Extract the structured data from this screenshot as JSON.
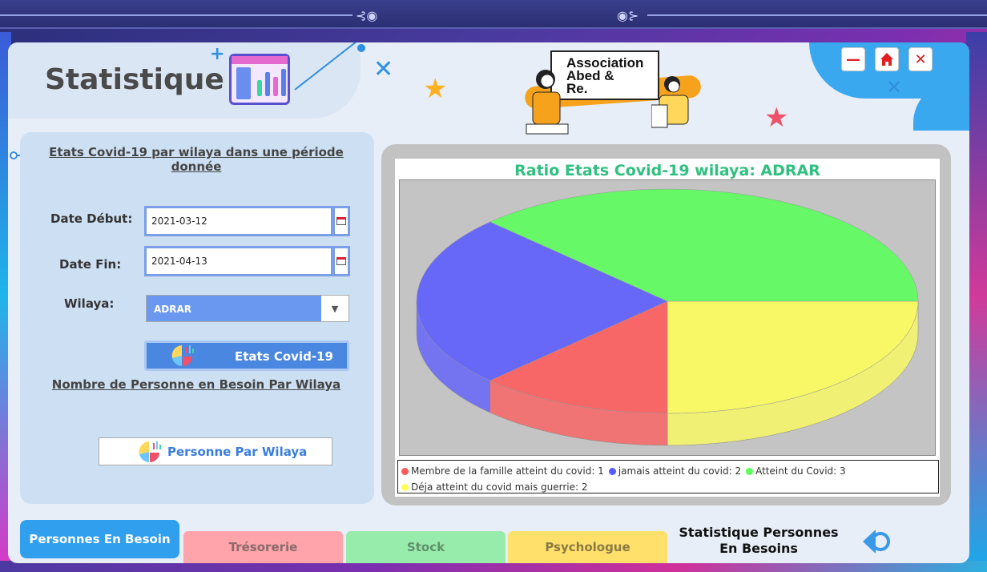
{
  "window": {
    "title": "Statistique"
  },
  "controls": {
    "minimize": "—",
    "home": "home-icon",
    "close": "✕"
  },
  "logo": {
    "line1": "Association",
    "line2": "Abed &",
    "line3": "Re."
  },
  "filter_panel": {
    "heading": "Etats Covid-19 par wilaya dans une période donnée",
    "date_start_label": "Date Début:",
    "date_start_value": "2021-03-12",
    "date_end_label": "Date Fin:",
    "date_end_value": "2021-04-13",
    "wilaya_label": "Wilaya:",
    "wilaya_value": "ADRAR",
    "covid_button": "Etats Covid-19",
    "people_link": "Nombre de Personne en Besoin Par Wilaya",
    "people_button": "Personne Par Wilaya"
  },
  "chart_data": {
    "type": "pie",
    "title": "Ratio Etats Covid-19 wilaya:  ADRAR",
    "categories": [
      "Membre de la famille atteint du covid",
      "jamais atteint du covid",
      "Atteint du Covid",
      "Déja atteint du covid mais guerrie"
    ],
    "values": [
      1,
      2,
      3,
      2
    ],
    "colors": [
      "#ff5a5a",
      "#5a5aff",
      "#5aff5a",
      "#ffff5a"
    ],
    "legend_labels": [
      "Membre de la famille atteint du covid: 1",
      "jamais atteint du covid: 2",
      "Atteint du Covid: 3",
      "Déja atteint du covid mais guerrie: 2"
    ],
    "legend_position": "bottom",
    "style": "3d"
  },
  "nav": {
    "tabs": [
      "Personnes En Besoin",
      "Trésorerie",
      "Stock",
      "Psychologue"
    ],
    "tab_colors": [
      "#2f9fee",
      "#ffa4ab",
      "#98ecab",
      "#ffe06a"
    ],
    "section_title": "Statistique Personnes En Besoins"
  }
}
